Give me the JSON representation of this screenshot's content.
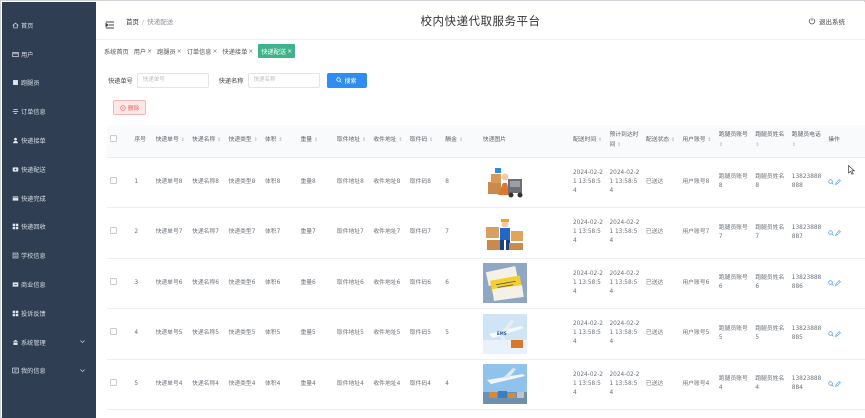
{
  "app_title": "校内快递代取服务平台",
  "logout_label": "退出系统",
  "breadcrumb": {
    "home": "首页",
    "current": "快递配送"
  },
  "sidebar": {
    "items": [
      {
        "label": "首页",
        "icon": "home-icon"
      },
      {
        "label": "用户",
        "icon": "user-icon"
      },
      {
        "label": "跑腿员",
        "icon": "runner-icon"
      },
      {
        "label": "订单信息",
        "icon": "list-icon"
      },
      {
        "label": "快递接单",
        "icon": "person-icon"
      },
      {
        "label": "快递配送",
        "icon": "truck-icon"
      },
      {
        "label": "快递完成",
        "icon": "box-icon"
      },
      {
        "label": "快递回收",
        "icon": "grid-icon"
      },
      {
        "label": "学校信息",
        "icon": "school-icon"
      },
      {
        "label": "商业信息",
        "icon": "shop-icon"
      },
      {
        "label": "投诉反馈",
        "icon": "grid-icon"
      },
      {
        "label": "系统管理",
        "icon": "system-icon",
        "expandable": true
      },
      {
        "label": "我的信息",
        "icon": "profile-icon",
        "expandable": true
      }
    ]
  },
  "tabs": [
    {
      "label": "系统首页",
      "closable": false,
      "active": false
    },
    {
      "label": "用户",
      "closable": true,
      "active": false
    },
    {
      "label": "跑腿员",
      "closable": true,
      "active": false
    },
    {
      "label": "订单信息",
      "closable": true,
      "active": false
    },
    {
      "label": "快递接单",
      "closable": true,
      "active": false
    },
    {
      "label": "快递配送",
      "closable": true,
      "active": true
    }
  ],
  "tab_close_glyph": "×",
  "search": {
    "field1_label": "快递单号",
    "field1_placeholder": "快递单号",
    "field2_label": "快递名称",
    "field2_placeholder": "快递名称",
    "button_label": "搜索"
  },
  "delete_label": "删除",
  "sort_glyph": "⇕",
  "table": {
    "headers": [
      "序号",
      "快递单号",
      "快递名称",
      "快递类型",
      "体积",
      "重量",
      "取件地址",
      "收件地址",
      "取件码",
      "酬金",
      "快递图片",
      "配送时间",
      "预计到达时间",
      "配送状态",
      "用户账号",
      "跑腿员账号",
      "跑腿员姓名",
      "跑腿员电话",
      "操作"
    ],
    "rows": [
      {
        "idx": "1",
        "no": "快递单号8",
        "name": "快递名称8",
        "type": "快递类型8",
        "vol": "体积8",
        "weight": "重量8",
        "pickup": "取件地址8",
        "recv": "收件地址8",
        "code": "取件码8",
        "fee": "8",
        "time": "2024-02-21 13:58:54",
        "eta": "2024-02-21 13:58:54",
        "status": "已送达",
        "user": "用户账号8",
        "runner": "跑腿员账号8",
        "rname": "跑腿员姓名8",
        "rphone": "13823888888",
        "img": "delivery-man"
      },
      {
        "idx": "2",
        "no": "快递单号7",
        "name": "快递名称7",
        "type": "快递类型7",
        "vol": "体积7",
        "weight": "重量7",
        "pickup": "取件地址7",
        "recv": "收件地址7",
        "code": "取件码7",
        "fee": "7",
        "time": "2024-02-21 13:58:54",
        "eta": "2024-02-21 13:58:54",
        "status": "已送达",
        "user": "用户账号7",
        "runner": "跑腿员账号7",
        "rname": "跑腿员姓名7",
        "rphone": "13823888887",
        "img": "courier-boxes"
      },
      {
        "idx": "3",
        "no": "快递单号6",
        "name": "快递名称6",
        "type": "快递类型6",
        "vol": "体积6",
        "weight": "重量6",
        "pickup": "取件地址6",
        "recv": "收件地址6",
        "code": "取件码6",
        "fee": "6",
        "time": "2024-02-21 13:58:54",
        "eta": "2024-02-21 13:58:54",
        "status": "已送达",
        "user": "用户账号6",
        "runner": "跑腿员账号6",
        "rname": "跑腿员姓名6",
        "rphone": "13823888886",
        "img": "tickets"
      },
      {
        "idx": "4",
        "no": "快递单号5",
        "name": "快递名称5",
        "type": "快递类型5",
        "vol": "体积5",
        "weight": "重量5",
        "pickup": "取件地址5",
        "recv": "收件地址5",
        "code": "取件码5",
        "fee": "5",
        "time": "2024-02-21 13:58:54",
        "eta": "2024-02-21 13:58:54",
        "status": "已送达",
        "user": "用户账号5",
        "runner": "跑腿员账号5",
        "rname": "跑腿员姓名5",
        "rphone": "13823888885",
        "img": "ems-plane"
      },
      {
        "idx": "5",
        "no": "快递单号4",
        "name": "快递名称4",
        "type": "快递类型4",
        "vol": "体积4",
        "weight": "重量4",
        "pickup": "取件地址4",
        "recv": "收件地址4",
        "code": "取件码4",
        "fee": "4",
        "time": "2024-02-21 13:58:54",
        "eta": "2024-02-21 13:58:54",
        "status": "已送达",
        "user": "用户账号4",
        "runner": "跑腿员账号4",
        "rname": "跑腿员姓名4",
        "rphone": "13823888884",
        "img": "cargo-plane"
      }
    ]
  },
  "colors": {
    "sidebar_bg": "#2f3e52",
    "accent_tab": "#3fb48a",
    "primary": "#2f8cf1",
    "danger": "#e35d5d"
  }
}
